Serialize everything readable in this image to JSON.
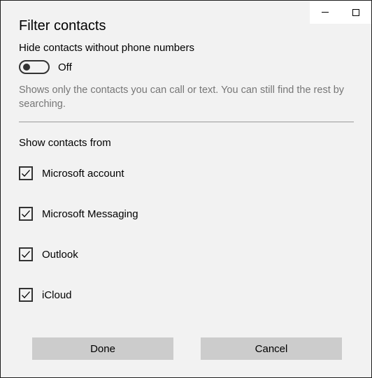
{
  "dialog": {
    "title": "Filter contacts",
    "hide_label": "Hide contacts without phone numbers",
    "toggle_state": "Off",
    "toggle_on": false,
    "description": "Shows only the contacts you can call or text. You can still find the rest by searching.",
    "section_label": "Show contacts from",
    "sources": [
      {
        "label": "Microsoft account",
        "checked": true
      },
      {
        "label": "Microsoft Messaging",
        "checked": true
      },
      {
        "label": "Outlook",
        "checked": true
      },
      {
        "label": "iCloud",
        "checked": true
      }
    ],
    "done_label": "Done",
    "cancel_label": "Cancel"
  },
  "window": {
    "caption_icons": [
      "minimize-icon",
      "maximize-icon"
    ]
  }
}
